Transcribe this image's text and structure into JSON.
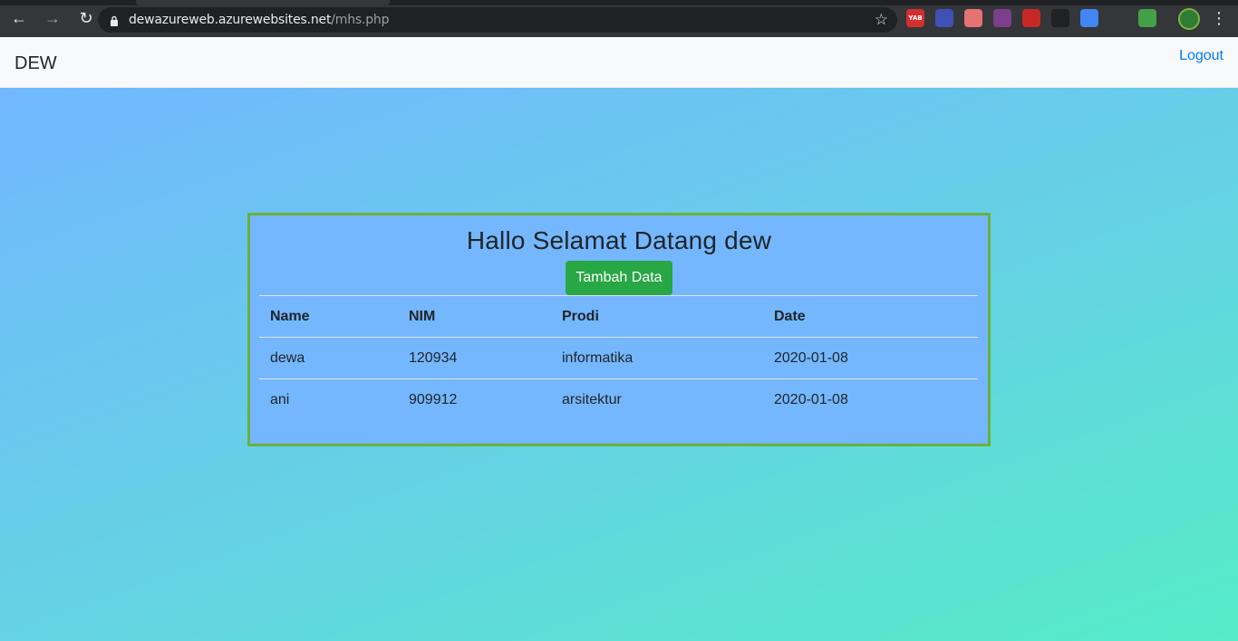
{
  "browser": {
    "url_host": "dewazureweb.azurewebsites.net",
    "url_path": "/mhs.php",
    "extensions": [
      {
        "name": "yab-extension-icon",
        "label": "YAB",
        "color": "#d32f2f"
      },
      {
        "name": "circle-extension-icon",
        "label": "",
        "color": "#3f51b5"
      },
      {
        "name": "shield-extension-icon",
        "label": "",
        "color": "#e57373"
      },
      {
        "name": "instagram-extension-icon",
        "label": "",
        "color": "#7b3f8c"
      },
      {
        "name": "media-extension-icon",
        "label": "",
        "color": "#c62828"
      },
      {
        "name": "eyes-extension-icon",
        "label": "",
        "color": "#202124"
      },
      {
        "name": "translate-extension-icon",
        "label": "",
        "color": "#4285f4"
      },
      {
        "name": "react-extension-icon",
        "label": "",
        "color": "#35363a"
      },
      {
        "name": "colorful-extension-icon",
        "label": "",
        "color": "#43a047"
      }
    ]
  },
  "navbar": {
    "brand": "DEW",
    "logout": "Logout"
  },
  "main": {
    "heading": "Hallo Selamat Datang dew",
    "add_button": "Tambah Data",
    "columns": [
      "Name",
      "NIM",
      "Prodi",
      "Date"
    ],
    "rows": [
      [
        "dewa",
        "120934",
        "informatika",
        "2020-01-08"
      ],
      [
        "ani",
        "909912",
        "arsitektur",
        "2020-01-08"
      ]
    ]
  },
  "colors": {
    "card_bg": "#74b7ff",
    "card_border": "#6ab23a",
    "button": "#28a745",
    "link": "#007bff"
  }
}
